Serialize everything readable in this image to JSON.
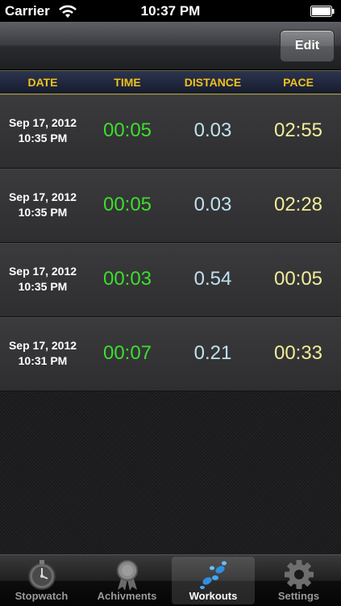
{
  "status_bar": {
    "carrier": "Carrier",
    "time": "10:37 PM"
  },
  "nav_bar": {
    "edit_label": "Edit"
  },
  "columns": {
    "date": "DATE",
    "time": "TIME",
    "distance": "DISTANCE",
    "pace": "PACE"
  },
  "workouts": [
    {
      "date": "Sep 17, 2012",
      "clock": "10:35 PM",
      "time": "00:05",
      "distance": "0.03",
      "pace": "02:55"
    },
    {
      "date": "Sep 17, 2012",
      "clock": "10:35 PM",
      "time": "00:05",
      "distance": "0.03",
      "pace": "02:28"
    },
    {
      "date": "Sep 17, 2012",
      "clock": "10:35 PM",
      "time": "00:03",
      "distance": "0.54",
      "pace": "00:05"
    },
    {
      "date": "Sep 17, 2012",
      "clock": "10:31 PM",
      "time": "00:07",
      "distance": "0.21",
      "pace": "00:33"
    }
  ],
  "tabs": [
    {
      "label": "Stopwatch",
      "icon": "stopwatch-icon"
    },
    {
      "label": "Achivments",
      "icon": "ribbon-icon"
    },
    {
      "label": "Workouts",
      "icon": "footprints-icon",
      "selected": true
    },
    {
      "label": "Settings",
      "icon": "gear-icon"
    }
  ],
  "colors": {
    "header_text": "#f3c11b",
    "time_value": "#3cde2d",
    "distance_value": "#bfe2ee",
    "pace_value": "#f2ec9a"
  }
}
